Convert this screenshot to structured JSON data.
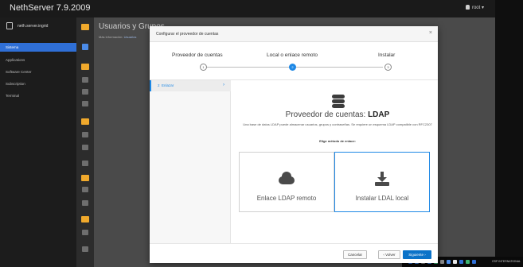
{
  "header": {
    "brand": "NethServer 7.9.2009",
    "user": "root"
  },
  "leftnav": {
    "server": "neth.server.ingrid",
    "items": [
      "Sistema",
      "Applications",
      "Software Center",
      "Subscription",
      "Terminal"
    ]
  },
  "page": {
    "title": "Usuarios y Grupos",
    "subtitle": "Más información:",
    "subtitle_link": "Usuarios"
  },
  "modal": {
    "title": "Configurar el proveedor de cuentas",
    "close": "×",
    "steps": [
      {
        "label": "Proveedor de cuentas",
        "num": "1"
      },
      {
        "label": "Local o enlace remoto",
        "num": "2"
      },
      {
        "label": "Instalar",
        "num": "3"
      }
    ],
    "sidebar": {
      "num": "2",
      "label": "Enlazar",
      "chevron": "›"
    },
    "body": {
      "title_prefix": "Proveedor de cuentas: ",
      "title_bold": "LDAP",
      "description": "Una base de datos LDAP puede almacenar usuarios, grupos y contraseñas. Se requiere un esquema LDAP compatible con RFC2307",
      "choose": "Elige método de enlace:",
      "option_remote": "Enlace LDAP remoto",
      "option_local": "Instalar LDAL local"
    },
    "footer": {
      "cancel": "Cancelar",
      "back": "‹ Volver",
      "next": "Siguiente ›"
    }
  },
  "taskbar": {
    "text": "ESP INTERNATIONAL"
  },
  "colors": {
    "accent": "#1e88e5",
    "nav_active": "#2f6fd6",
    "folder": "#f0a92c",
    "primary_button": "#0a72c8"
  }
}
